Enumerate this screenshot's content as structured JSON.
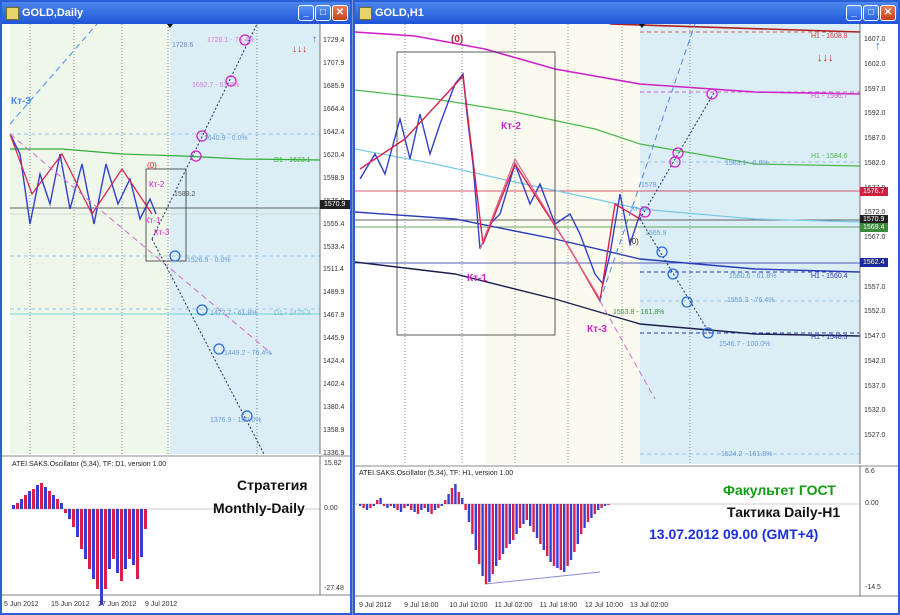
{
  "left_window": {
    "title": "GOLD,Daily",
    "price_ticks": [
      "1729.4",
      "1707.9",
      "1685.9",
      "1664.4",
      "1642.4",
      "1620.4",
      "1598.9",
      "1576.9",
      "1555.4",
      "1533.4",
      "1511.4",
      "1489.9",
      "1467.9",
      "1445.9",
      "1424.4",
      "1402.4",
      "1380.4",
      "1358.9",
      "1336.9"
    ],
    "current_price": "1570.9",
    "date_ticks": [
      "5 Jun 2012",
      "15 Jun 2012",
      "27 Jun 2012",
      "9 Jul 2012"
    ],
    "osc_title": "ATEI.SAKS.Oscillator (5,34), TF: D1, version 1.00",
    "osc_ticks": [
      "15.82",
      "0.00",
      "-27.48"
    ],
    "strategy_line1": "Стратегия",
    "strategy_line2": "Monthly-Daily",
    "wave_labels": {
      "kt3_left": "Кт-3",
      "kt2": "Кт-2",
      "kt1": "Кт-1",
      "kt3": "Кт-3",
      "zero": "(0)"
    },
    "levels": {
      "l1728": "1728.6",
      "l1726": "1726.1 - 76.4%",
      "l1692": "1692.7 - 61.8%",
      "l1640": "1640.9 - 0.0%",
      "d1": "D1 - 1623.1",
      "l1589": "1589.2",
      "l1526": "1526.9 - 0.0%",
      "l1477": "1477.7 - 61.8%",
      "d1b": "D1 - 1475.3",
      "l1449": "1449.2 - 76.4%",
      "l1376": "1376.9 - 100.0%"
    }
  },
  "right_window": {
    "title": "GOLD,H1",
    "price_ticks": [
      "1607.0",
      "1602.0",
      "1597.0",
      "1592.0",
      "1587.0",
      "1582.0",
      "1577.0",
      "1572.0",
      "1567.0",
      "1562.0",
      "1557.0",
      "1552.0",
      "1547.0",
      "1542.0",
      "1537.0",
      "1532.0",
      "1527.0"
    ],
    "price_tags": [
      "1576.7",
      "1570.9",
      "1569.4",
      "1562.4"
    ],
    "date_ticks": [
      "9 Jul 2012",
      "9 Jul 18:00",
      "10 Jul 10:00",
      "11 Jul 02:00",
      "11 Jul 18:00",
      "12 Jul 10:00",
      "13 Jul 02:00"
    ],
    "osc_title": "ATEI.SAKS.Oscillator (5,34), TF: H1, version 1.00",
    "osc_ticks": [
      "6.6",
      "0.00",
      "-14.5"
    ],
    "wave_labels": {
      "zero": "(0)",
      "kt2": "Кт-2",
      "kt1": "Кт-1",
      "kt3": "Кт-3",
      "kt3_small": "Кт-3",
      "zero_small": "(0)"
    },
    "levels": {
      "h1a": "H1 - 1608.8",
      "h1b": "H1 - 1596.7",
      "h1c": "H1 - 1584.6",
      "l1583": "1583.1 - 0.0%",
      "l1578": "1578.",
      "l1565": "1565.9",
      "l1560": "1560.6 - 61.8%",
      "h1d": "H1 - 1560.4",
      "l1555": "1555.3 - 76.4%",
      "l1553": "1553.8 - 161.8%",
      "h1e": "H1 - 1548.3",
      "l1546": "1546.7 - 100.0%",
      "l1524": "1524.2 - 161.8%"
    },
    "caption": {
      "line1": "Факультет ГОСТ",
      "line2": "Тактика Daily-H1",
      "line3": "13.07.2012  09.00 (GMT+4)"
    }
  },
  "colors": {
    "title_blue": "#2a5fd6",
    "caption_green": "#129a12",
    "caption_blue": "#1b2ee0"
  }
}
